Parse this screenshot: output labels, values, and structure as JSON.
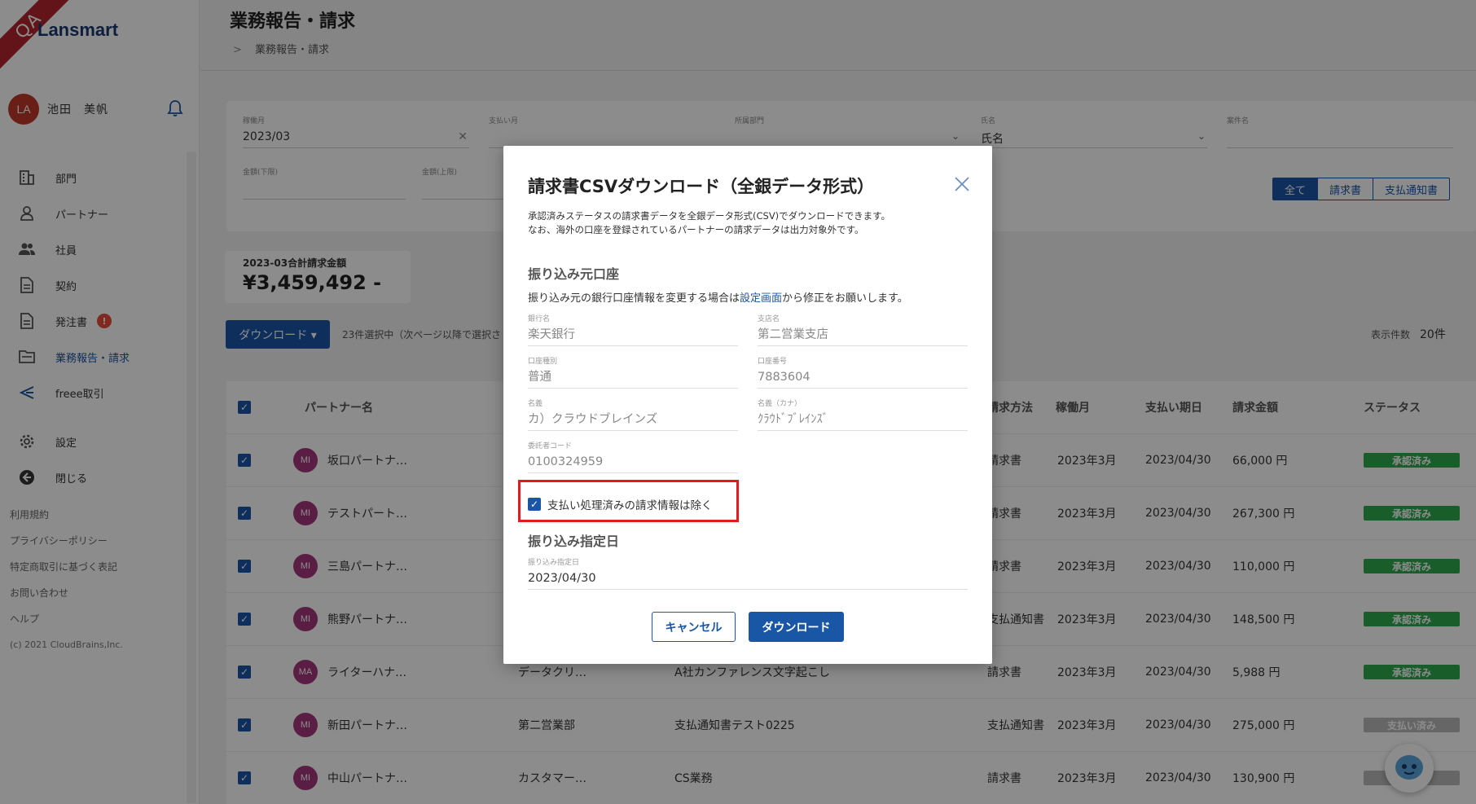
{
  "sidebar": {
    "ribbon": "QA",
    "logo": "Lansmart",
    "user_initials": "LA",
    "user_name": "池田　美帆",
    "nav": [
      {
        "label": "部門"
      },
      {
        "label": "パートナー"
      },
      {
        "label": "社員"
      },
      {
        "label": "契約"
      },
      {
        "label": "発注書",
        "badge": "!"
      },
      {
        "label": "業務報告・請求"
      },
      {
        "label": "freee取引"
      },
      {
        "label": "設定"
      },
      {
        "label": "閉じる"
      }
    ],
    "footer": [
      "利用規約",
      "プライバシーポリシー",
      "特定商取引に基づく表記",
      "お問い合わせ",
      "ヘルプ",
      "(c) 2021 CloudBrains,Inc."
    ]
  },
  "header": {
    "title": "業務報告・請求",
    "breadcrumb": "業務報告・請求"
  },
  "filters": {
    "work_month_label": "稼働月",
    "work_month_value": "2023/03",
    "pay_month_label": "支払い月",
    "dept_label": "所属部門",
    "name_label": "氏名",
    "name_value": "氏名",
    "matter_label": "案件名",
    "amount_min_label": "金額(下限)",
    "amount_max_label": "金額(上限)",
    "segments": [
      "全て",
      "請求書",
      "支払通知書"
    ]
  },
  "summary": {
    "label": "2023-03合計請求金額",
    "amount": "¥3,459,492 -"
  },
  "toolbar": {
    "download_label": "ダウンロード ▾",
    "selection_info": "23件選択中（次ページ以降で選択さ",
    "per_page_label": "表示件数",
    "per_page_value": "20件"
  },
  "table": {
    "headers": {
      "partner": "パートナー名",
      "method": "請求方法",
      "month": "稼働月",
      "due": "支払い期日",
      "amount": "請求金額",
      "status": "ステータス"
    },
    "rows": [
      {
        "initials": "MI",
        "partner": "坂口パートナ…",
        "dept": "",
        "matter": "",
        "method": "請求書",
        "month": "2023年3月",
        "due": "2023/04/30",
        "amount": "66,000 円",
        "status": "承認済み",
        "status_kind": "ok"
      },
      {
        "initials": "MI",
        "partner": "テストパート…",
        "dept": "",
        "matter": "",
        "method": "請求書",
        "month": "2023年3月",
        "due": "2023/04/30",
        "amount": "267,300 円",
        "status": "承認済み",
        "status_kind": "ok"
      },
      {
        "initials": "MI",
        "partner": "三島パートナ…",
        "dept": "",
        "matter": "",
        "method": "請求書",
        "month": "2023年3月",
        "due": "2023/04/30",
        "amount": "110,000 円",
        "status": "承認済み",
        "status_kind": "ok"
      },
      {
        "initials": "MI",
        "partner": "熊野パートナ…",
        "dept": "",
        "matter": "",
        "method": "支払通知書",
        "month": "2023年3月",
        "due": "2023/04/30",
        "amount": "148,500 円",
        "status": "承認済み",
        "status_kind": "ok"
      },
      {
        "initials": "MA",
        "partner": "ライターハナ…",
        "dept": "データクリ…",
        "matter": "A社カンファレンス文字起こし",
        "method": "請求書",
        "month": "2023年3月",
        "due": "2023/04/30",
        "amount": "5,988 円",
        "status": "承認済み",
        "status_kind": "ok"
      },
      {
        "initials": "MI",
        "partner": "新田パートナ…",
        "dept": "第二営業部",
        "matter": "支払通知書テスト0225",
        "method": "支払通知書",
        "month": "2023年3月",
        "due": "2023/04/30",
        "amount": "275,000 円",
        "status": "支払い済み",
        "status_kind": "paid"
      },
      {
        "initials": "MI",
        "partner": "中山パートナ…",
        "dept": "カスタマー…",
        "matter": "CS業務",
        "method": "請求書",
        "month": "2023年3月",
        "due": "2023/04/30",
        "amount": "130,900 円",
        "status": "",
        "status_kind": "paid"
      }
    ]
  },
  "modal": {
    "title": "請求書CSVダウンロード（全銀データ形式）",
    "desc_line1": "承認済みステータスの請求書データを全銀データ形式(CSV)でダウンロードできます。",
    "desc_line2": "なお、海外の口座を登録されているパートナーの請求データは出力対象外です。",
    "section_account": "振り込み元口座",
    "note_prefix": "振り込み元の銀行口座情報を変更する場合は",
    "note_link": "設定画面",
    "note_suffix": "から修正をお願いします。",
    "bank_label": "銀行名",
    "bank_value": "楽天銀行",
    "branch_label": "支店名",
    "branch_value": "第二営業支店",
    "type_label": "口座種別",
    "type_value": "普通",
    "number_label": "口座番号",
    "number_value": "7883604",
    "holder_label": "名義",
    "holder_value": "カ）クラウドブレインズ",
    "holder_kana_label": "名義（カナ）",
    "holder_kana_value": "ｸﾗｳﾄﾞﾌﾞﾚｲﾝｽﾞ",
    "consignor_label": "委託者コード",
    "consignor_value": "0100324959",
    "exclude_paid_label": "支払い処理済みの請求情報は除く",
    "section_date": "振り込み指定日",
    "date_label": "振り込み指定日",
    "date_value": "2023/04/30",
    "cancel_label": "キャンセル",
    "download_label": "ダウンロード"
  },
  "colors": {
    "primary": "#1a56a6",
    "approved": "#2eaa4f",
    "highlight": "#e11b22",
    "ribbon": "#b3262c"
  }
}
